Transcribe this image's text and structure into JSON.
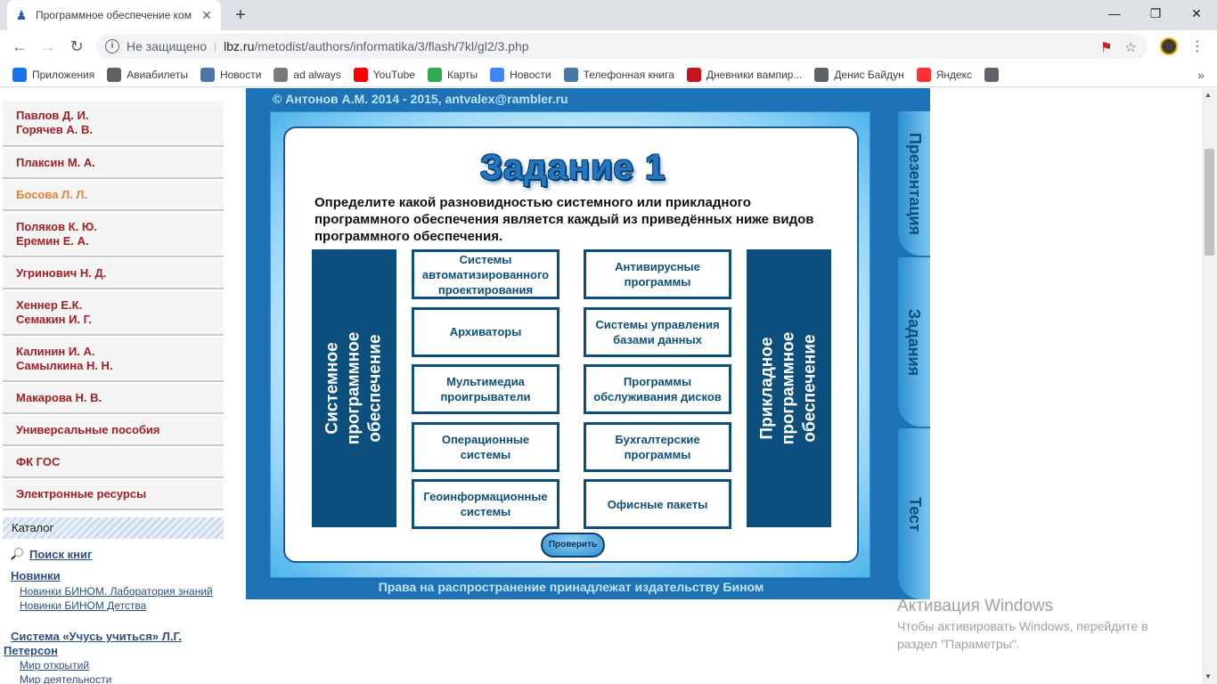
{
  "browser": {
    "tab_title": "Программное обеспечение ком",
    "security_label": "Не защищено",
    "url_host": "lbz.ru",
    "url_path": "/metodist/authors/informatika/3/flash/7kl/gl2/3.php",
    "bookmarks": [
      {
        "label": "Приложения",
        "icon": "apps-grid-icon",
        "color": "#1a73e8"
      },
      {
        "label": "Авиабилеты",
        "icon": "globe-icon",
        "color": "#5f6368"
      },
      {
        "label": "Новости",
        "icon": "vk-icon",
        "color": "#4a76a8"
      },
      {
        "label": "ad always",
        "icon": "page-icon",
        "color": "#7a7a7a"
      },
      {
        "label": "YouTube",
        "icon": "youtube-icon",
        "color": "#ff0000"
      },
      {
        "label": "Карты",
        "icon": "maps-icon",
        "color": "#34a853"
      },
      {
        "label": "Новости",
        "icon": "google-news-icon",
        "color": "#4285f4"
      },
      {
        "label": "Телефонная книга",
        "icon": "vk-icon",
        "color": "#4a76a8"
      },
      {
        "label": "Дневники вампир...",
        "icon": "wa-icon",
        "color": "#c4161c"
      },
      {
        "label": "Денис Байдун",
        "icon": "globe-icon",
        "color": "#5f6368"
      },
      {
        "label": "Яндекс",
        "icon": "yandex-icon",
        "color": "#f33"
      },
      {
        "label": "",
        "icon": "globe-icon",
        "color": "#5f6368"
      }
    ]
  },
  "sidebar": {
    "items": [
      {
        "line1": "Павлов Д. И.",
        "line2": "Горячев А. В.",
        "active": false
      },
      {
        "line1": "Плаксин М. А.",
        "line2": "",
        "active": false
      },
      {
        "line1": "Босова Л. Л.",
        "line2": "",
        "active": true
      },
      {
        "line1": "Поляков К. Ю.",
        "line2": "Еремин Е. А.",
        "active": false
      },
      {
        "line1": "Угринович Н. Д.",
        "line2": "",
        "active": false
      },
      {
        "line1": "Хеннер Е.К.",
        "line2": "Семакин И. Г.",
        "active": false
      },
      {
        "line1": "Калинин И. А.",
        "line2": "Самылкина Н. Н.",
        "active": false
      },
      {
        "line1": "Макарова Н. В.",
        "line2": "",
        "active": false
      },
      {
        "line1": "Универсальные пособия",
        "line2": "",
        "active": false
      },
      {
        "line1": "ФК ГОС",
        "line2": "",
        "active": false
      },
      {
        "line1": "Электронные ресурсы",
        "line2": "",
        "active": false
      }
    ],
    "catalog_label": "Каталог",
    "search_label": "Поиск книг",
    "novelties_label": "Новинки",
    "novelties_links": [
      "Новинки БИНОМ. Лаборатория знаний",
      "Новинки БИНОМ Детства"
    ],
    "system_label_1": "Система «Учусь учиться» Л.Г.",
    "system_label_2": "Петерсон",
    "system_links": [
      "Мир открытий",
      "Мир деятельности"
    ]
  },
  "activity": {
    "copyright": "© Антонов А.М. 2014 - 2015, antvalex@rambler.ru",
    "title": "Задание 1",
    "task": "Определите какой разновидностью системного или прикладного программного обеспечения является каждый из приведённых ниже видов программного обеспечения.",
    "left_panel": "Системное программное обеспечение",
    "right_panel": "Прикладное программное обеспечение",
    "options_left": [
      "Системы автоматизированного проектирования",
      "Архиваторы",
      "Мультимедиа проигрыватели",
      "Операционные системы",
      "Геоинформационные системы"
    ],
    "options_right": [
      "Антивирусные программы",
      "Системы управления базами данных",
      "Программы обслуживания дисков",
      "Бухгалтерские программы",
      "Офисные пакеты"
    ],
    "check_button": "Проверить",
    "side_tabs": [
      "Презентация",
      "Задания",
      "Тест"
    ],
    "credit": "Права на распространение принадлежат издательству Бином"
  },
  "activation": {
    "title": "Активация Windows",
    "subtitle": "Чтобы активировать Windows, перейдите в раздел \"Параметры\"."
  }
}
